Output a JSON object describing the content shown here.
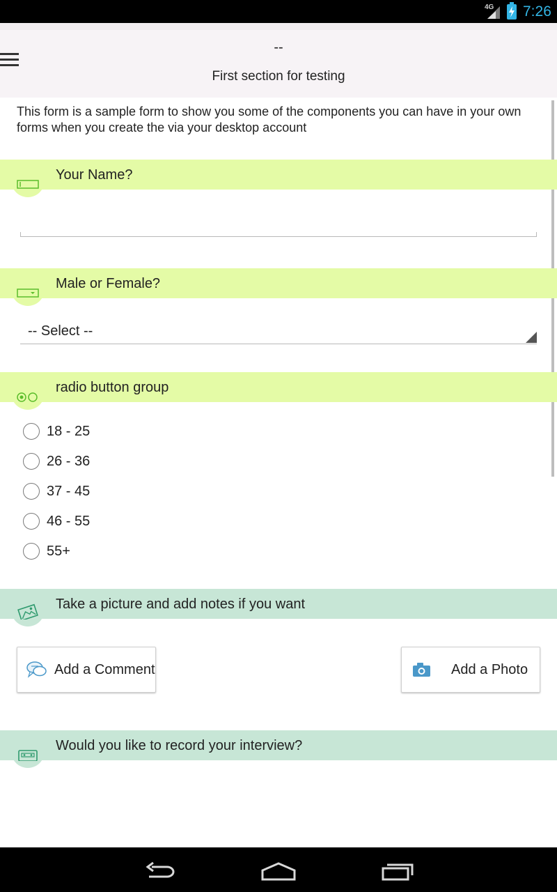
{
  "status_bar": {
    "network": "4G",
    "time": "7:26",
    "icons": [
      "signal-icon",
      "battery-charging-icon"
    ]
  },
  "header": {
    "form_title": "--",
    "section_title": "First section for testing",
    "menu_icon": "hamburger-menu-icon"
  },
  "intro_text": "This form is a sample form to show you some of the components you can have in your own forms when you create the via your desktop account",
  "colors": {
    "question_bar_green": "#e4fba6",
    "question_bar_mint": "#c7e6d6",
    "icon_green": "#5bbd2b",
    "icon_teal": "#2f9a6e",
    "camera_blue": "#4a98c9"
  },
  "questions": [
    {
      "label": "Your Name?",
      "icon": "text-field-icon",
      "type": "text",
      "value": ""
    },
    {
      "label": "Male or Female?",
      "icon": "dropdown-icon",
      "type": "select",
      "selected": "-- Select --"
    },
    {
      "label": "radio button group",
      "icon": "radio-group-icon",
      "type": "radio",
      "options": [
        "18 - 25",
        "26 - 36",
        "37 - 45",
        "46 - 55",
        "55+"
      ]
    },
    {
      "label": "Take a picture and add notes if you want",
      "icon": "photo-notes-icon",
      "type": "photo",
      "buttons": {
        "comment": "Add a Comment",
        "photo": "Add a Photo"
      }
    },
    {
      "label": "Would you like to record your interview?",
      "icon": "cassette-icon",
      "type": "audio"
    }
  ],
  "navbar": {
    "icons": [
      "back-icon",
      "home-icon",
      "recent-apps-icon"
    ]
  }
}
